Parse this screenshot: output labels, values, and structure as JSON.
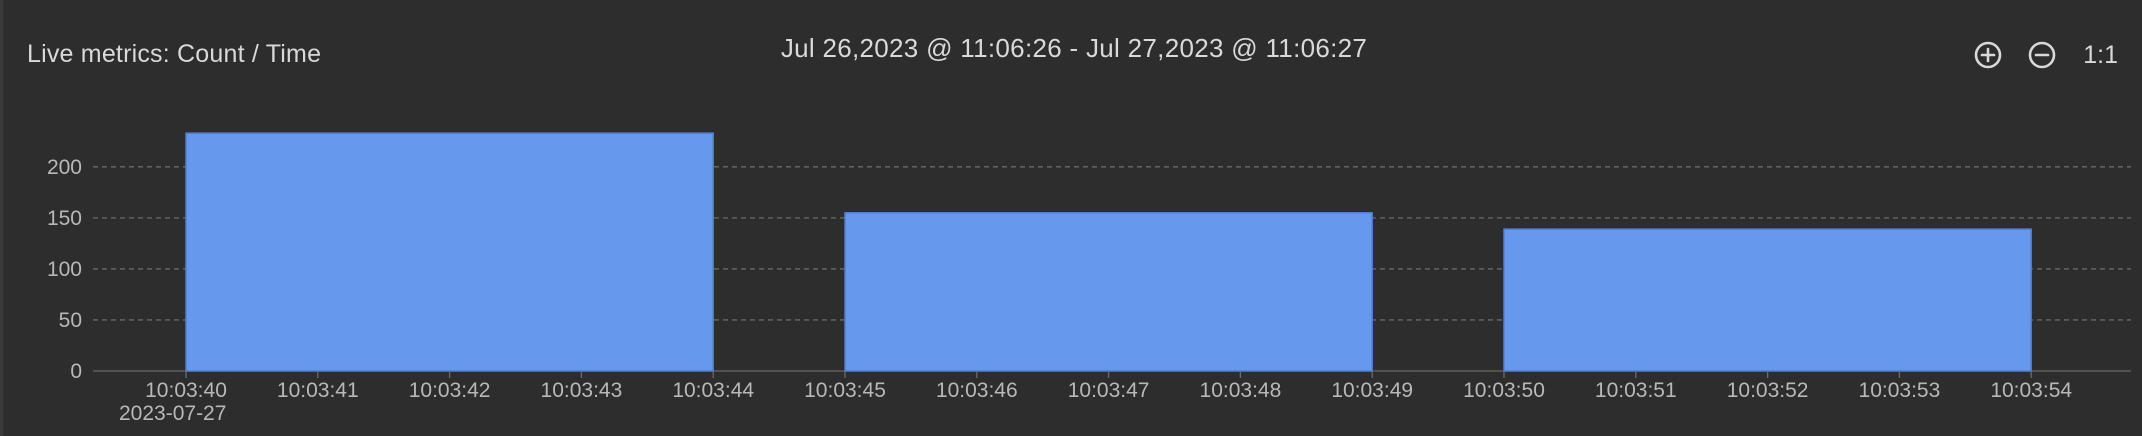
{
  "panel": {
    "title": "Live metrics: Count / Time",
    "time_range": "Jul 26,2023 @ 11:06:26 - Jul 27,2023 @ 11:06:27",
    "controls": {
      "zoom_in_icon": "plus-circle-icon",
      "zoom_out_icon": "minus-circle-icon",
      "reset_label": "1:1"
    }
  },
  "colors": {
    "background": "#2d2d2d",
    "bar_fill": "#6699ee",
    "bar_stroke": "#4f7fd0",
    "grid": "#6a6a6a",
    "text": "#d9d9d9"
  },
  "chart_data": {
    "type": "bar",
    "title": "Live metrics: Count / Time",
    "xlabel": "",
    "ylabel": "",
    "ylim": [
      0,
      240
    ],
    "yticks": [
      0,
      50,
      100,
      150,
      200
    ],
    "ytick_labels": [
      "0",
      "50",
      "100",
      "150",
      "200"
    ],
    "grid": true,
    "x_tick_labels": [
      "10:03:40",
      "10:03:41",
      "10:03:42",
      "10:03:43",
      "10:03:44",
      "10:03:45",
      "10:03:46",
      "10:03:47",
      "10:03:48",
      "10:03:49",
      "10:03:50",
      "10:03:51",
      "10:03:52",
      "10:03:53",
      "10:03:54"
    ],
    "x_date_label": "2023-07-27",
    "bars": [
      {
        "start": "10:03:40",
        "end": "10:03:44",
        "start_index": 0,
        "end_index": 4,
        "value": 233
      },
      {
        "start": "10:03:45",
        "end": "10:03:49",
        "start_index": 5,
        "end_index": 9,
        "value": 155
      },
      {
        "start": "10:03:50",
        "end": "10:03:54",
        "start_index": 10,
        "end_index": 14,
        "value": 139
      }
    ]
  }
}
